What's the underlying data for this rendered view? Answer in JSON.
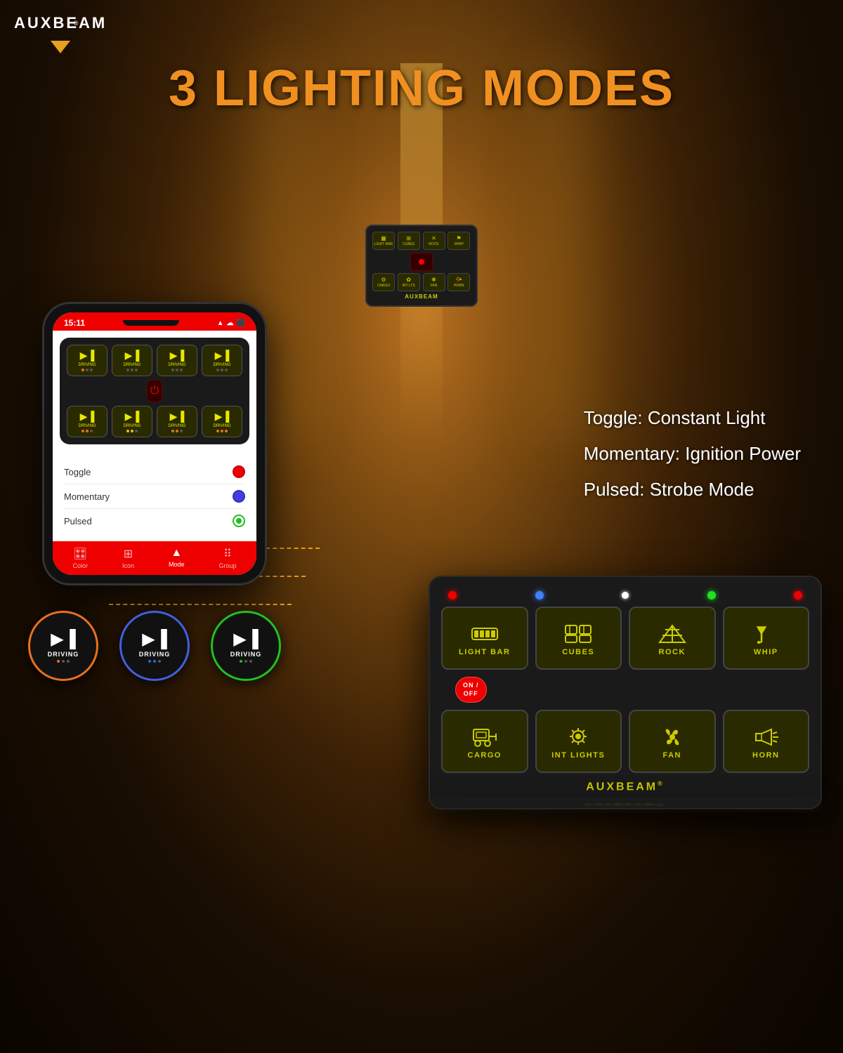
{
  "brand": {
    "name": "AUXBEAM",
    "registered": "®",
    "triangle": "▼"
  },
  "header": {
    "title": "3 LIGHTING MODES"
  },
  "phone": {
    "status_time": "15:11",
    "status_icons": "▲ ▼ ⬛",
    "screen_mode": "Mode",
    "nav_items": [
      {
        "label": "Color",
        "icon": "🎛"
      },
      {
        "label": "Icon",
        "icon": "⊞"
      },
      {
        "label": "Mode",
        "icon": "▲",
        "active": true
      },
      {
        "label": "Group",
        "icon": "⠿"
      }
    ],
    "mode_items": [
      {
        "label": "Toggle",
        "type": "red"
      },
      {
        "label": "Momentary",
        "type": "blue"
      },
      {
        "label": "Pulsed",
        "type": "green"
      }
    ],
    "driving_circles": [
      {
        "label": "DRIVING",
        "dots": [
          "orange",
          "gray",
          "gray"
        ]
      },
      {
        "label": "DRIVING",
        "dots": [
          "blue",
          "blue",
          "gray"
        ]
      },
      {
        "label": "DRIVING",
        "dots": [
          "green",
          "gray",
          "gray"
        ]
      }
    ]
  },
  "labels": {
    "toggle": "Toggle: Constant Light",
    "momentary": "Momentary: Ignition Power",
    "pulsed": "Pulsed: Strobe Mode"
  },
  "control_panel": {
    "row1_buttons": [
      {
        "id": "light-bar",
        "label": "LIGHT BAR",
        "icon": "lightbar"
      },
      {
        "id": "cubes",
        "label": "CUBES",
        "icon": "cubes"
      },
      {
        "id": "rock",
        "label": "ROCK",
        "icon": "rock"
      },
      {
        "id": "whip",
        "label": "WHIP",
        "icon": "whip"
      }
    ],
    "row2_buttons": [
      {
        "id": "cargo",
        "label": "CARGO",
        "icon": "cargo"
      },
      {
        "id": "int-lights",
        "label": "INT LIGHTS",
        "icon": "intlights"
      },
      {
        "id": "fan",
        "label": "FAN",
        "icon": "fan"
      },
      {
        "id": "horn",
        "label": "HORN",
        "icon": "horn"
      }
    ],
    "onoff_label": "ON / OFF",
    "brand": "AUXBEAM",
    "brand_reg": "®"
  },
  "small_panel": {
    "row1": [
      "LIGHT BAR",
      "CUBES",
      "ROCK",
      "WHIP"
    ],
    "row2": [
      "CARGO",
      "INT LIGHTS",
      "FAN",
      "HORN"
    ],
    "brand": "AUXBEAM"
  }
}
